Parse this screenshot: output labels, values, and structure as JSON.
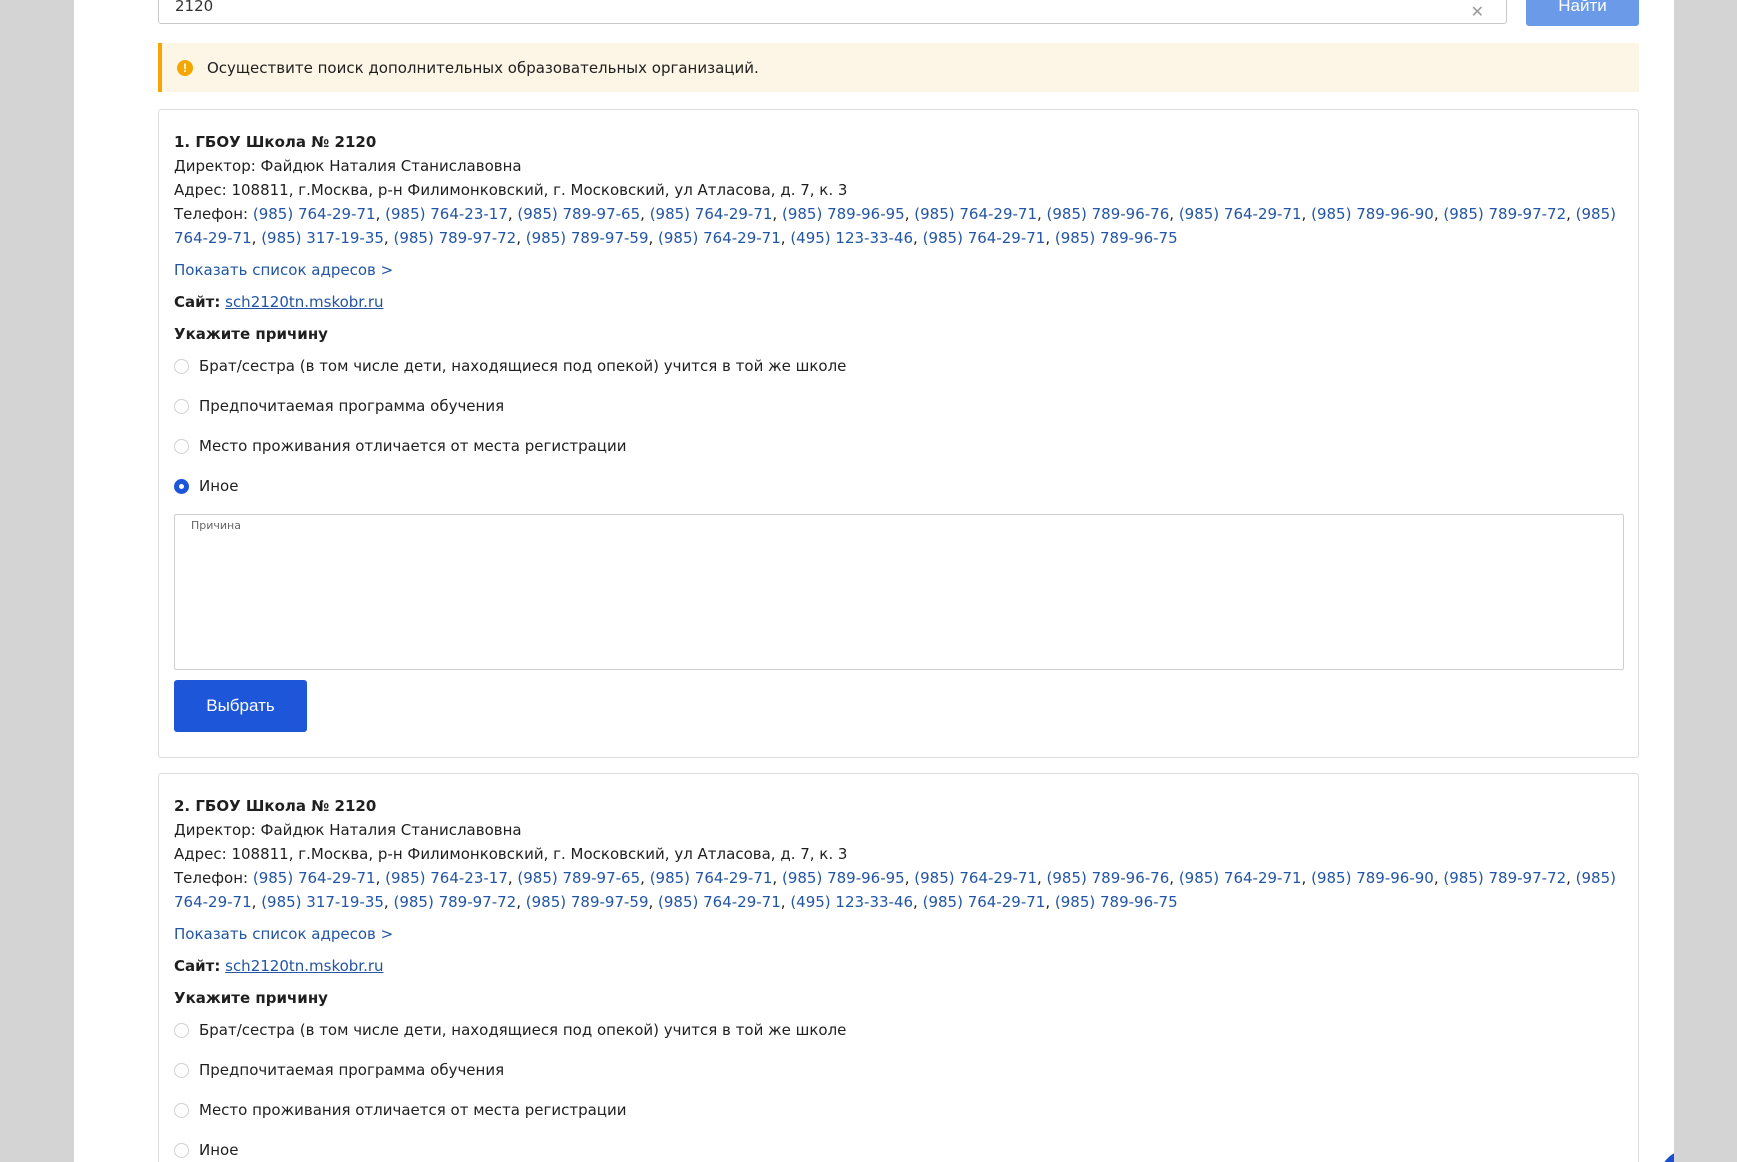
{
  "search": {
    "value": "2120",
    "button_label": "Найти"
  },
  "notice": {
    "text": "Осуществите поиск дополнительных образовательных организаций."
  },
  "phone_prefix": "Телефон: ",
  "phones": [
    "(985) 764-29-71",
    "(985) 764-23-17",
    "(985) 789-97-65",
    "(985) 764-29-71",
    "(985) 789-96-95",
    "(985) 764-29-71",
    "(985) 789-96-76",
    "(985) 764-29-71",
    "(985) 789-96-90",
    "(985) 789-97-72",
    "(985) 764-29-71",
    "(985) 317-19-35",
    "(985) 789-97-72",
    "(985) 789-97-59",
    "(985) 764-29-71",
    "(495) 123-33-46",
    "(985) 764-29-71",
    "(985) 789-96-75"
  ],
  "cards": [
    {
      "title": "1. ГБОУ Школа № 2120",
      "director": "Директор: Файдюк Наталия Станиславовна",
      "address": "Адрес: 108811, г.Москва, р-н Филимонковский, г. Московский, ул Атласова, д. 7, к. 3",
      "show_addresses": "Показать список адресов >",
      "site_label": "Сайт:",
      "site_link": "sch2120tn.mskobr.ru",
      "reason_title": "Укажите причину",
      "reasons": [
        "Брат/сестра (в том числе дети, находящиеся под опекой) учится в той же школе",
        "Предпочитаемая программа обучения",
        "Место проживания отличается от места регистрации",
        "Иное"
      ],
      "selected_reason": 3,
      "textarea_label": "Причина",
      "select_button": "Выбрать"
    },
    {
      "title": "2. ГБОУ Школа № 2120",
      "director": "Директор: Файдюк Наталия Станиславовна",
      "address": "Адрес: 108811, г.Москва, р-н Филимонковский, г. Московский, ул Атласова, д. 7, к. 3",
      "show_addresses": "Показать список адресов >",
      "site_label": "Сайт:",
      "site_link": "sch2120tn.mskobr.ru",
      "reason_title": "Укажите причину",
      "reasons": [
        "Брат/сестра (в том числе дети, находящиеся под опекой) учится в той же школе",
        "Предпочитаемая программа обучения",
        "Место проживания отличается от места регистрации",
        "Иное"
      ]
    }
  ],
  "colors": {
    "primary": "#1d56d8",
    "link": "#2255a4",
    "warning": "#f4a700",
    "notice_bg": "#fdf5e6"
  }
}
